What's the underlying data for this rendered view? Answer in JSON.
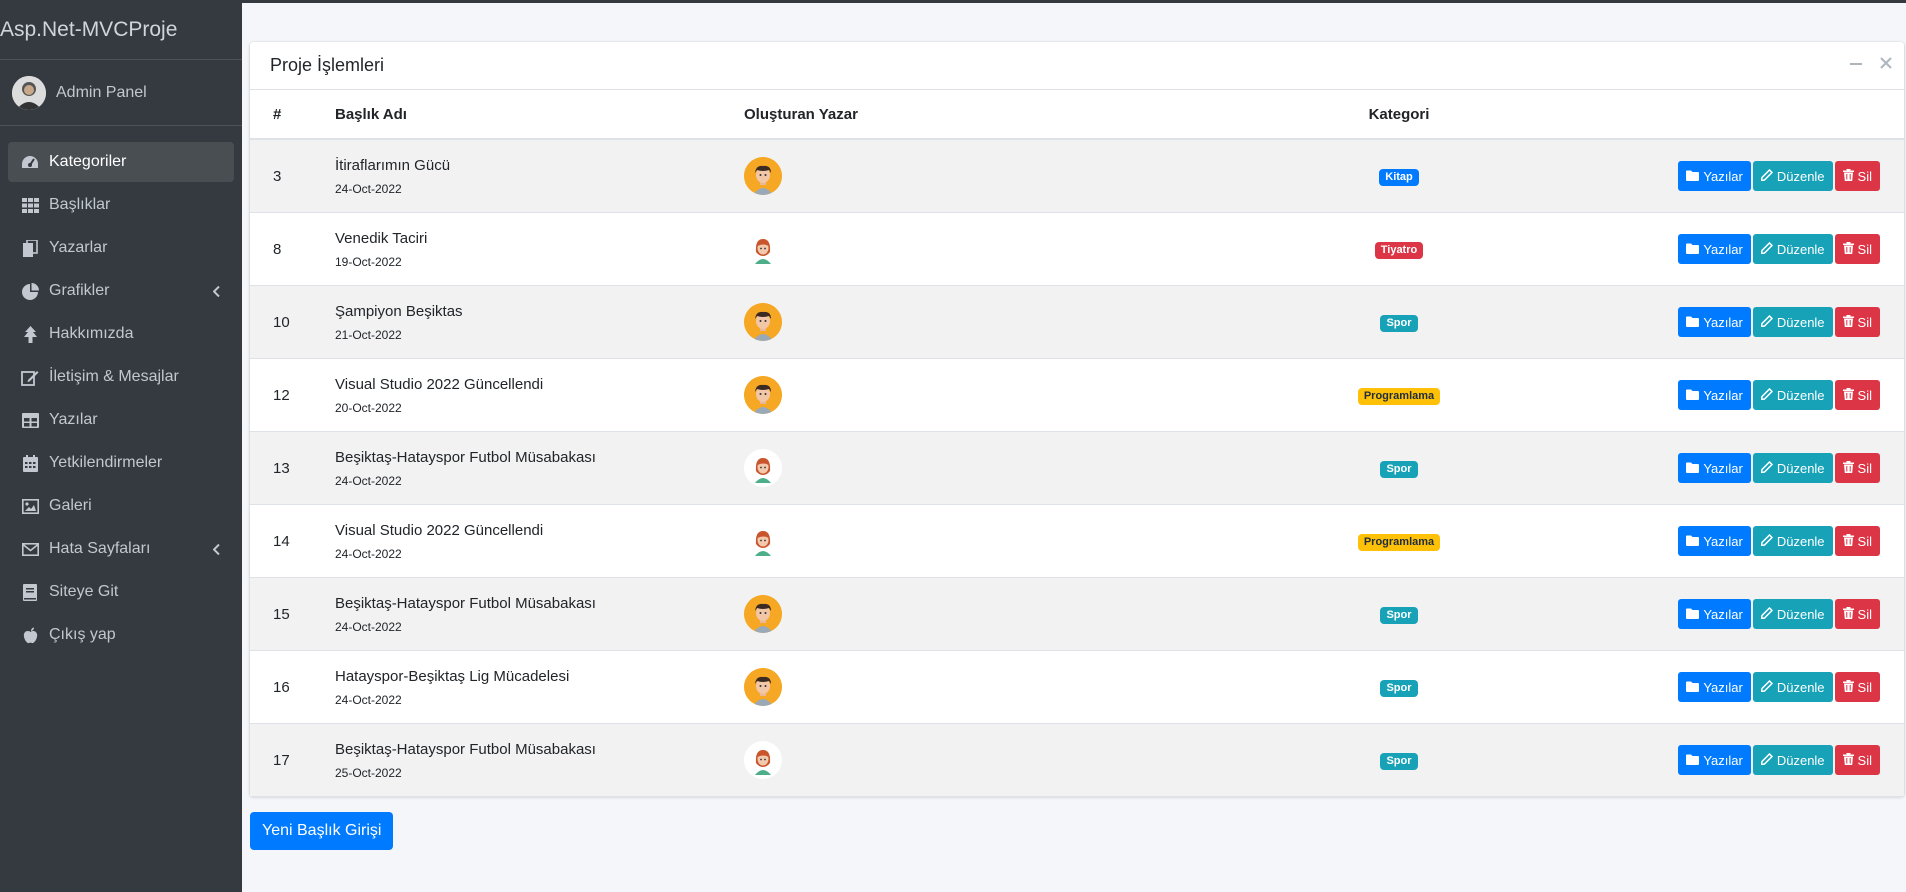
{
  "brand": "Asp.Net-MVCProje",
  "user": {
    "name": "Admin Panel"
  },
  "sidebar": {
    "items": [
      {
        "label": "Kategoriler",
        "icon": "tachometer-icon",
        "active": true
      },
      {
        "label": "Başlıklar",
        "icon": "grid-icon"
      },
      {
        "label": "Yazarlar",
        "icon": "copy-icon"
      },
      {
        "label": "Grafikler",
        "icon": "pie-chart-icon",
        "arrow": true
      },
      {
        "label": "Hakkımızda",
        "icon": "tree-icon"
      },
      {
        "label": "İletişim & Mesajlar",
        "icon": "edit-icon"
      },
      {
        "label": "Yazılar",
        "icon": "table-icon"
      },
      {
        "label": "Yetkilendirmeler",
        "icon": "calendar-icon"
      },
      {
        "label": "Galeri",
        "icon": "image-icon"
      },
      {
        "label": "Hata Sayfaları",
        "icon": "envelope-icon",
        "arrow": true
      },
      {
        "label": "Siteye Git",
        "icon": "book-icon"
      },
      {
        "label": "Çıkış yap",
        "icon": "apple-icon"
      }
    ]
  },
  "card": {
    "title": "Proje İşlemleri",
    "columns": {
      "id": "#",
      "title": "Başlık Adı",
      "author": "Oluşturan Yazar",
      "category": "Kategori"
    },
    "buttons": {
      "posts": "Yazılar",
      "edit": "Düzenle",
      "delete": "Sil"
    },
    "rows": [
      {
        "id": "3",
        "title": "İtiraflarımın Gücü",
        "date": "24-Oct-2022",
        "avatar": "male",
        "category": "Kitap",
        "cat_color": "#007bff",
        "cat_text": "#ffffff"
      },
      {
        "id": "8",
        "title": "Venedik Taciri",
        "date": "19-Oct-2022",
        "avatar": "female",
        "category": "Tiyatro",
        "cat_color": "#dc3545",
        "cat_text": "#ffffff"
      },
      {
        "id": "10",
        "title": "Şampiyon Beşiktas",
        "date": "21-Oct-2022",
        "avatar": "male",
        "category": "Spor",
        "cat_color": "#17a2b8",
        "cat_text": "#ffffff"
      },
      {
        "id": "12",
        "title": "Visual Studio 2022 Güncellendi",
        "date": "20-Oct-2022",
        "avatar": "male",
        "category": "Programlama",
        "cat_color": "#ffc107",
        "cat_text": "#1f2d3d"
      },
      {
        "id": "13",
        "title": "Beşiktaş-Hatayspor Futbol Müsabakası",
        "date": "24-Oct-2022",
        "avatar": "female",
        "category": "Spor",
        "cat_color": "#17a2b8",
        "cat_text": "#ffffff"
      },
      {
        "id": "14",
        "title": "Visual Studio 2022 Güncellendi",
        "date": "24-Oct-2022",
        "avatar": "female",
        "category": "Programlama",
        "cat_color": "#ffc107",
        "cat_text": "#1f2d3d"
      },
      {
        "id": "15",
        "title": "Beşiktaş-Hatayspor Futbol Müsabakası",
        "date": "24-Oct-2022",
        "avatar": "male",
        "category": "Spor",
        "cat_color": "#17a2b8",
        "cat_text": "#ffffff"
      },
      {
        "id": "16",
        "title": "Hatayspor-Beşiktaş Lig Mücadelesi",
        "date": "24-Oct-2022",
        "avatar": "male",
        "category": "Spor",
        "cat_color": "#17a2b8",
        "cat_text": "#ffffff"
      },
      {
        "id": "17",
        "title": "Beşiktaş-Hatayspor Futbol Müsabakası",
        "date": "25-Oct-2022",
        "avatar": "female",
        "category": "Spor",
        "cat_color": "#17a2b8",
        "cat_text": "#ffffff"
      }
    ]
  },
  "new_button": "Yeni Başlık Girişi"
}
